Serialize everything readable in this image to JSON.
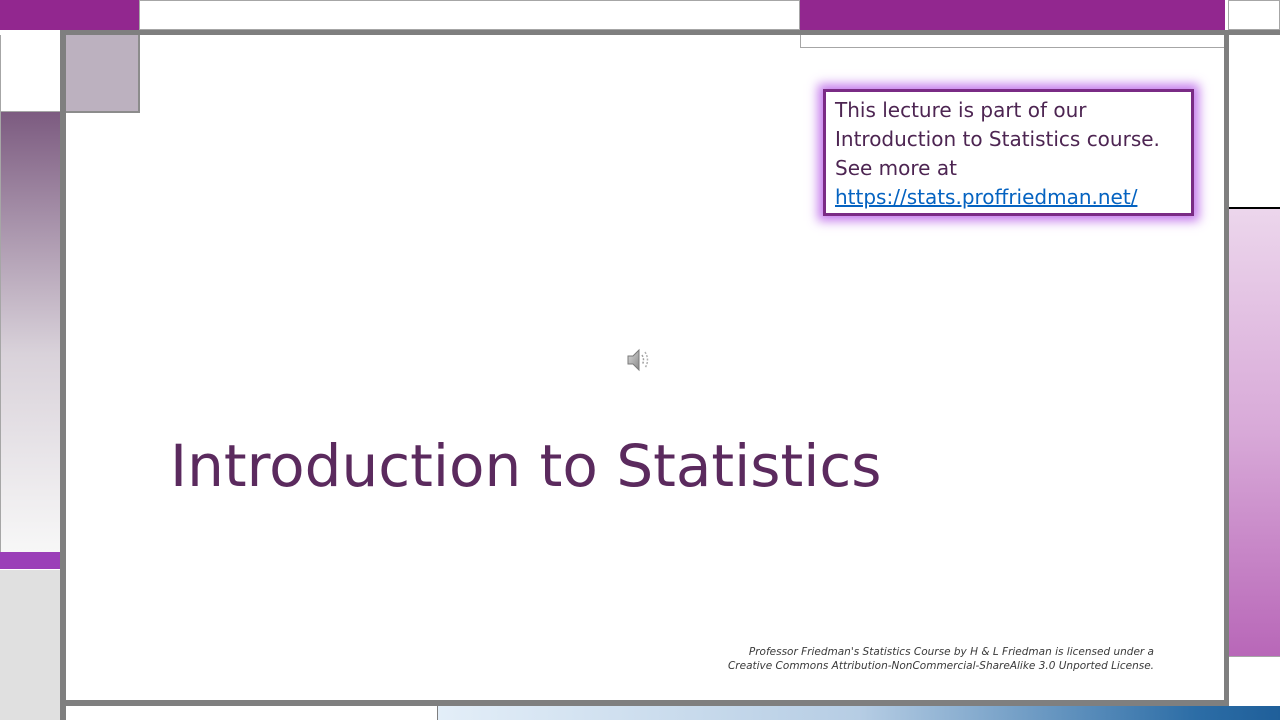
{
  "slide": {
    "title": "Introduction to Statistics",
    "info_box": {
      "line1": "This lecture is part of our",
      "line2": "Introduction to Statistics course.",
      "line3": "See more at",
      "link_text": "https://stats.proffriedman.net/"
    },
    "license": {
      "line1": "Professor Friedman's Statistics Course by  H & L Friedman is licensed under a",
      "line2": "Creative Commons Attribution-NonCommercial-ShareAlike 3.0 Unported License."
    },
    "audio_icon": "speaker-icon"
  },
  "colors": {
    "accent_purple": "#92278f",
    "title_color": "#5b2a5e",
    "link_blue": "#0563c1",
    "frame_gray": "#7f7f7f"
  }
}
